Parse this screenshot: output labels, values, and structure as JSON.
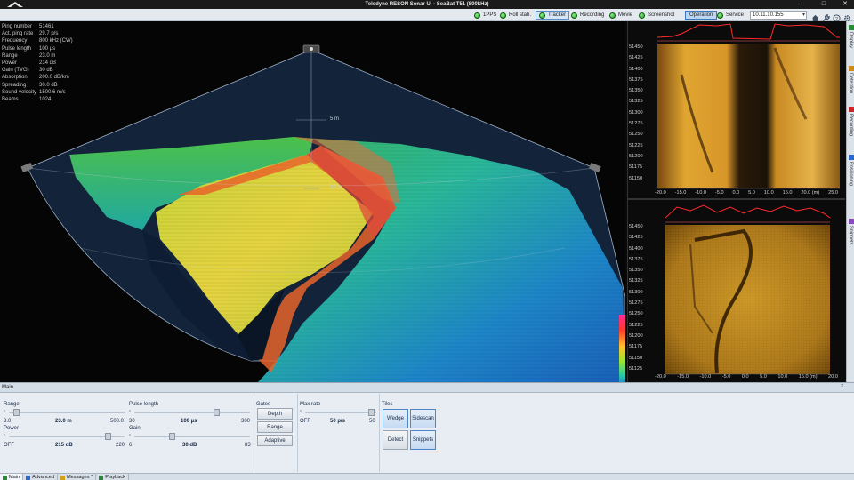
{
  "window": {
    "title": "Teledyne RESON Sonar UI - SeaBat T51 (800kHz)"
  },
  "toolbar": {
    "items": [
      {
        "label": "1PPS",
        "status": "ok"
      },
      {
        "label": "Roll stab.",
        "status": "ok"
      },
      {
        "label": "Tracker",
        "status": "ok"
      },
      {
        "label": "Recording",
        "status": "ok"
      },
      {
        "label": "Movie",
        "status": "ok"
      },
      {
        "label": "Screenshot",
        "status": "ok"
      },
      {
        "label": "Operation"
      },
      {
        "label": "Service",
        "status": "ok"
      }
    ],
    "ip_address": "10.11.10.155",
    "icons": [
      "home-icon",
      "wrench-icon",
      "help-icon",
      "gear-icon"
    ]
  },
  "sonar_params": [
    {
      "key": "Ping number",
      "value": "51461"
    },
    {
      "key": "Act. ping rate",
      "value": "29.7 p/s"
    },
    {
      "key": "Frequency",
      "value": "800 kHz (CW)"
    },
    {
      "key": "Pulse length",
      "value": "100 µs"
    },
    {
      "key": "Range",
      "value": "23.0 m"
    },
    {
      "key": "Power",
      "value": "214 dB"
    },
    {
      "key": "Gain (TVG)",
      "value": "30 dB"
    },
    {
      "key": "Absorption",
      "value": "200.0 dB/km"
    },
    {
      "key": "Spreading",
      "value": "30.0 dB"
    },
    {
      "key": "Sound velocity",
      "value": "1500.6 m/s"
    },
    {
      "key": "Beams",
      "value": "1024"
    }
  ],
  "wedge": {
    "range_label_5": "5 m",
    "range_label_10": "10 m"
  },
  "waterfall_top": {
    "y_ticks": [
      "51450",
      "51425",
      "51400",
      "51375",
      "51350",
      "51325",
      "51300",
      "51275",
      "51250",
      "51225",
      "51200",
      "51175",
      "51150"
    ],
    "x_ticks": [
      "-20.0",
      "-15.0",
      "-10.0",
      "-5.0",
      "0.0",
      "5.0",
      "10.0",
      "15.0",
      "20.0 (m)",
      "25.0"
    ]
  },
  "waterfall_bottom": {
    "y_ticks": [
      "51450",
      "51425",
      "51400",
      "51375",
      "51350",
      "51325",
      "51300",
      "51275",
      "51250",
      "51225",
      "51200",
      "51175",
      "51150",
      "51125"
    ],
    "x_ticks": [
      "-20.0",
      "-15.0",
      "-10.0",
      "-5.0",
      "0.0",
      "5.0",
      "10.0",
      "15.0 (m)",
      "20.0"
    ]
  },
  "side_tabs": [
    "Display",
    "Detection",
    "Recording",
    "Positioning",
    "Snippets"
  ],
  "main_panel": {
    "title": "Main",
    "range": {
      "label": "Range",
      "min": "3.0",
      "value": "23.0 m",
      "max": "500.0",
      "fraction": 0.04
    },
    "power": {
      "label": "Power",
      "min": "OFF",
      "value": "215 dB",
      "max": "220",
      "fraction": 0.88
    },
    "pulse_length": {
      "label": "Pulse length",
      "min": "30",
      "value": "100 µs",
      "max": "300",
      "fraction": 0.72
    },
    "gain": {
      "label": "Gain",
      "min": "6",
      "value": "30 dB",
      "max": "83",
      "fraction": 0.32
    },
    "gates": {
      "label": "Gates",
      "buttons": [
        "Depth",
        "Range",
        "Adaptive"
      ]
    },
    "max_rate": {
      "label": "Max rate",
      "min": "OFF",
      "value": "50 p/s",
      "max": "50",
      "fraction": 0.97
    },
    "tiles": {
      "label": "Tiles",
      "buttons": [
        "Wedge",
        "Sidescan",
        "Detect",
        "Snippets"
      ]
    }
  },
  "bottom_tabs": [
    {
      "label": "Main",
      "active": true
    },
    {
      "label": "Advanced"
    },
    {
      "label": "Messages *"
    },
    {
      "label": "Playback"
    }
  ],
  "colors": {
    "accent": "#3d79c0",
    "status_ok": "#1f9a1f"
  }
}
